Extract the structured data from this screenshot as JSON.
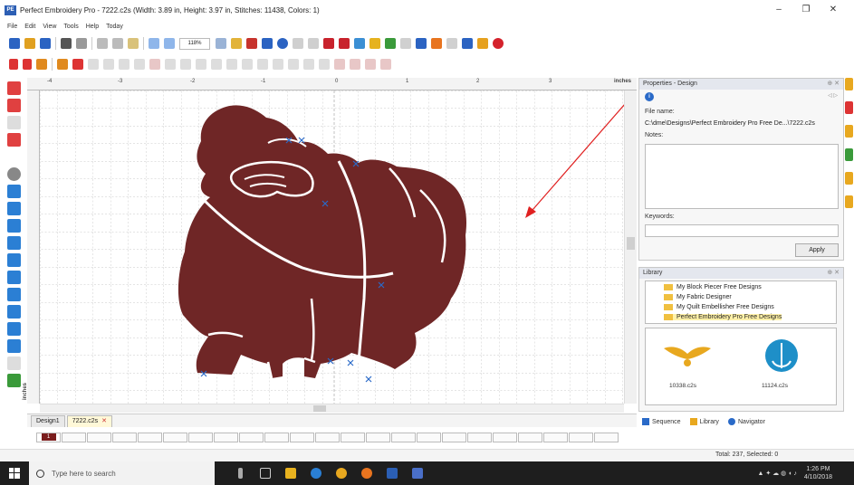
{
  "window": {
    "title": "Perfect Embroidery Pro - 7222.c2s (Width: 3.89 in, Height: 3.97 in, Stitches: 11438, Colors: 1)",
    "app_badge": "PE",
    "minimize": "–",
    "maximize": "❐",
    "close": "✕"
  },
  "menu": [
    "File",
    "Edit",
    "View",
    "Tools",
    "Help",
    "Today"
  ],
  "toolbar": {
    "zoom": "118%"
  },
  "ruler": {
    "unit": "inches",
    "marks": [
      "-4",
      "-3",
      "-2",
      "-1",
      "0",
      "1",
      "2",
      "3"
    ]
  },
  "tabs": [
    {
      "label": "Design1",
      "active": false
    },
    {
      "label": "7222.c2s",
      "active": true
    }
  ],
  "tab_close": "✕",
  "frames": {
    "first": "1"
  },
  "status": {
    "text": "Total: 237, Selected: 0"
  },
  "properties": {
    "title": "Properties - Design",
    "file_name_label": "File name:",
    "file_name_value": "C:\\dme\\Designs\\Perfect Embroidery Pro Free De...\\7222.c2s",
    "notes_label": "Notes:",
    "keywords_label": "Keywords:",
    "apply": "Apply",
    "nav": "◁ ▷"
  },
  "library": {
    "title": "Library",
    "items": [
      "My Block Piecer Free Designs",
      "My Fabric Designer",
      "My Quilt Embellisher Free Designs",
      "Perfect Embroidery Pro Free Designs"
    ],
    "thumbs": [
      "10338.c2s",
      "11124.c2s"
    ]
  },
  "panel_tabs": [
    "Sequence",
    "Library",
    "Navigator"
  ],
  "taskbar": {
    "search_placeholder": "Type here to search",
    "time": "1:26 PM",
    "date": "4/10/2018"
  },
  "colors": {
    "gorilla": "#6f2626",
    "stitch": "#ffffff",
    "annotation_arrow": "#e02020",
    "accent": "#2a6ac8"
  }
}
